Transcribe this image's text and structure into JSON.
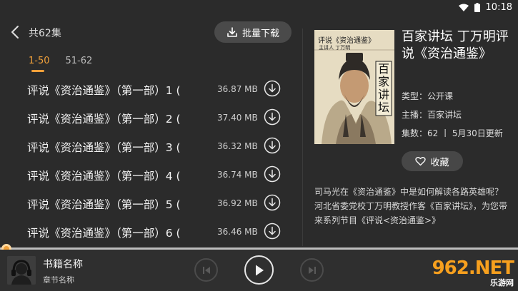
{
  "status_bar": {
    "time": "10:18"
  },
  "header": {
    "episode_count": "共62集",
    "batch_download_label": "批量下载"
  },
  "tabs": [
    {
      "label": "1-50"
    },
    {
      "label": "51-62"
    }
  ],
  "episodes": [
    {
      "title": "评说《资治通鉴》（第一部）1 (",
      "size": "36.87 MB"
    },
    {
      "title": "评说《资治通鉴》（第一部）2 (",
      "size": "37.40 MB"
    },
    {
      "title": "评说《资治通鉴》（第一部）3 (",
      "size": "36.32 MB"
    },
    {
      "title": "评说《资治通鉴》（第一部）4 (",
      "size": "36.74 MB"
    },
    {
      "title": "评说《资治通鉴》（第一部）5 (",
      "size": "36.92 MB"
    },
    {
      "title": "评说《资治通鉴》（第一部）6 (",
      "size": "36.46 MB"
    }
  ],
  "book": {
    "cover_title": "评说《资治通鉴》",
    "cover_author": "主讲人 丁万明",
    "cover_series": "百家讲坛",
    "title": "百家讲坛 丁万明评说《资治通鉴》",
    "type": "类型：公开课",
    "host": "主播：百家讲坛",
    "episodes_updated": "集数：62 丨 5月30日更新",
    "collect_label": "收藏",
    "description": "司马光在《资治通鉴》中是如何解读各路英雄呢？ 河北省委党校丁万明教授作客《百家讲坛》，为您带来系列节目《评说<资治通鉴>》"
  },
  "player": {
    "book_name": "书籍名称",
    "chapter_name": "章节名称",
    "progress": 0.0
  },
  "watermark": {
    "big": "962.NET",
    "small": "乐游网"
  },
  "colors": {
    "accent": "#f0a03a",
    "background": "#2b2b2b"
  }
}
